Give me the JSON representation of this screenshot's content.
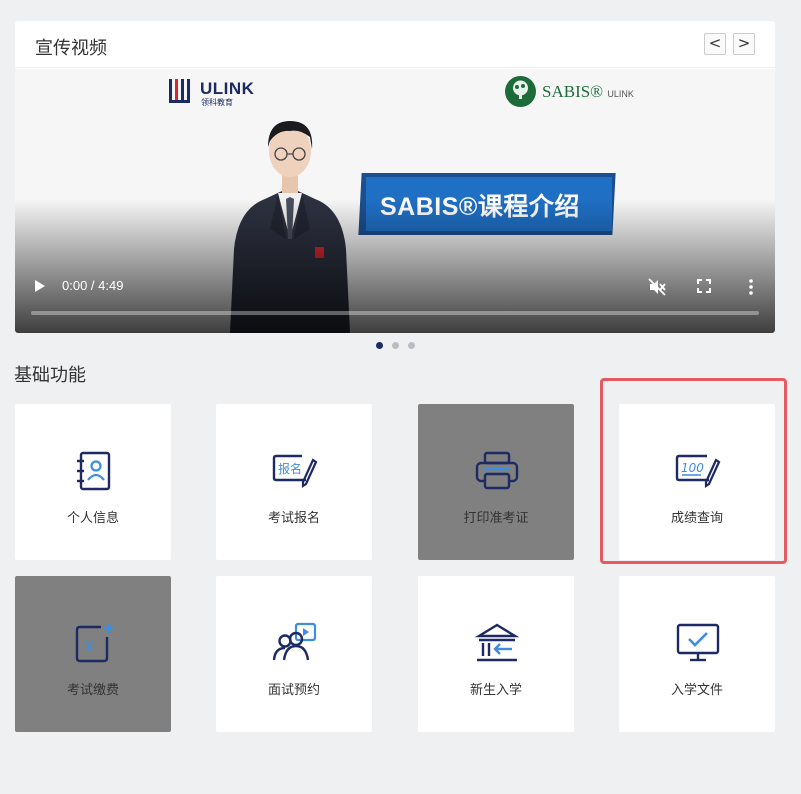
{
  "video_section": {
    "title": "宣传视频",
    "prev_symbol": "<",
    "next_symbol": ">",
    "ulink_logo_text": "ULINK",
    "ulink_logo_subtext": "领科教育",
    "sabis_logo_text": "SABIS®",
    "sabis_logo_suffix": "ULINK",
    "banner_text": "SABIS®课程介绍",
    "player": {
      "time": "0:00 / 4:49",
      "progress_fraction": 0.0,
      "muted": true
    },
    "carousel": {
      "slide_count": 3,
      "active_index": 0
    }
  },
  "functions": {
    "title": "基础功能",
    "tiles": [
      {
        "label": "个人信息",
        "icon": "contact-book-icon",
        "disabled": false,
        "highlighted": false
      },
      {
        "label": "考试报名",
        "icon": "exam-signup-icon",
        "disabled": false,
        "highlighted": false
      },
      {
        "label": "打印准考证",
        "icon": "printer-icon",
        "disabled": true,
        "highlighted": false
      },
      {
        "label": "成绩查询",
        "icon": "score-query-icon",
        "disabled": false,
        "highlighted": true
      },
      {
        "label": "考试缴费",
        "icon": "payment-icon",
        "disabled": true,
        "highlighted": false
      },
      {
        "label": "面试预约",
        "icon": "interview-icon",
        "disabled": false,
        "highlighted": false
      },
      {
        "label": "新生入学",
        "icon": "enrollment-icon",
        "disabled": false,
        "highlighted": false
      },
      {
        "label": "入学文件",
        "icon": "document-monitor-icon",
        "disabled": false,
        "highlighted": false
      }
    ]
  },
  "colors": {
    "icon_primary": "#1d2a63",
    "icon_accent": "#3f8de0",
    "disabled_tile": "#7f807f",
    "highlight_border": "#e85a62"
  }
}
